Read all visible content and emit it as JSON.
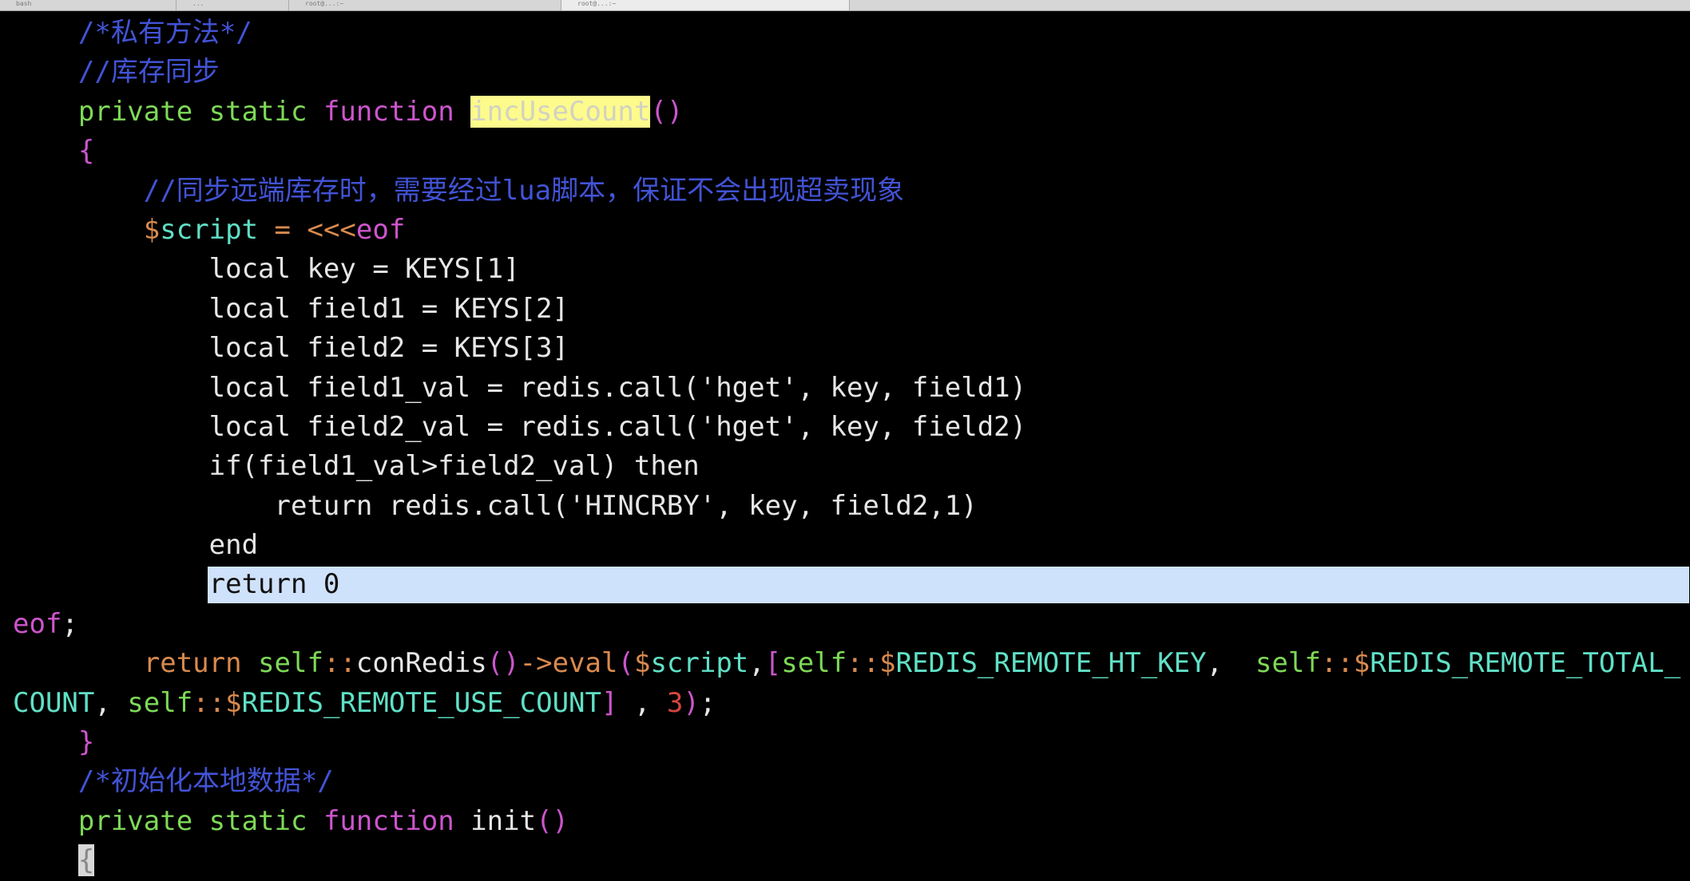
{
  "tabs": [
    {
      "label": "bash"
    },
    {
      "label": "..."
    },
    {
      "label": "root@...:~"
    },
    {
      "label": "root@...:~"
    }
  ],
  "colors": {
    "background": "#000000",
    "comment": "#4253d6",
    "keyword": "#7ed957",
    "function": "#cd55cd",
    "operator": "#d98a4e",
    "variable": "#60e0c6",
    "search_highlight": "#fdfb8c",
    "selection": "#cfe2fb"
  },
  "editor": {
    "selected_line_index": 14,
    "lines": [
      [
        {
          "t": "    "
        },
        {
          "t": "/*私有方法*/",
          "c": "comment"
        }
      ],
      [
        {
          "t": "    "
        },
        {
          "t": "//库存同步",
          "c": "comment"
        }
      ],
      [
        {
          "t": "    "
        },
        {
          "t": "private static ",
          "c": "kw"
        },
        {
          "t": "function ",
          "c": "fn"
        },
        {
          "t": "incUseCount",
          "c": "hl"
        },
        {
          "t": "()",
          "c": "punc"
        }
      ],
      [
        {
          "t": "    "
        },
        {
          "t": "{",
          "c": "punc"
        }
      ],
      [
        {
          "t": "        "
        },
        {
          "t": "//同步远端库存时，需要经过lua脚本，保证不会出现超卖现象",
          "c": "comment"
        }
      ],
      [
        {
          "t": "        "
        },
        {
          "t": "$",
          "c": "op"
        },
        {
          "t": "script",
          "c": "var"
        },
        {
          "t": " = <<<",
          "c": "op"
        },
        {
          "t": "eof",
          "c": "fn"
        }
      ],
      [
        {
          "t": "            local key = KEYS[1]"
        }
      ],
      [
        {
          "t": "            local field1 = KEYS[2]"
        }
      ],
      [
        {
          "t": "            local field2 = KEYS[3]"
        }
      ],
      [
        {
          "t": "            local field1_val = redis.call('hget', key, field1)"
        }
      ],
      [
        {
          "t": "            local field2_val = redis.call('hget', key, field2)"
        }
      ],
      [
        {
          "t": "            if(field1_val>field2_val) then"
        }
      ],
      [
        {
          "t": "                return redis.call('HINCRBY', key, field2,1)"
        }
      ],
      [
        {
          "t": "            end"
        }
      ],
      [
        {
          "t": "            "
        },
        {
          "t": "return 0",
          "c": "sel"
        }
      ],
      [
        {
          "t": "eof",
          "c": "fn"
        },
        {
          "t": ";"
        }
      ],
      [
        {
          "t": "        "
        },
        {
          "t": "return ",
          "c": "op"
        },
        {
          "t": "self",
          "c": "kw"
        },
        {
          "t": "::",
          "c": "op"
        },
        {
          "t": "conRedis"
        },
        {
          "t": "()",
          "c": "punc"
        },
        {
          "t": "->",
          "c": "op"
        },
        {
          "t": "eval",
          "c": "op"
        },
        {
          "t": "(",
          "c": "punc"
        },
        {
          "t": "$",
          "c": "op"
        },
        {
          "t": "script",
          "c": "var"
        },
        {
          "t": ","
        },
        {
          "t": "[",
          "c": "punc"
        },
        {
          "t": "self",
          "c": "kw"
        },
        {
          "t": "::",
          "c": "op"
        },
        {
          "t": "$",
          "c": "op"
        },
        {
          "t": "REDIS_REMOTE_HT_KEY",
          "c": "var"
        },
        {
          "t": ",  "
        },
        {
          "t": "self",
          "c": "kw"
        },
        {
          "t": "::",
          "c": "op"
        },
        {
          "t": "$",
          "c": "op"
        },
        {
          "t": "REDIS_REMOTE_TOTAL_",
          "c": "var"
        }
      ],
      [
        {
          "t": "COUNT",
          "c": "var"
        },
        {
          "t": ", "
        },
        {
          "t": "self",
          "c": "kw"
        },
        {
          "t": "::",
          "c": "op"
        },
        {
          "t": "$",
          "c": "op"
        },
        {
          "t": "REDIS_REMOTE_USE_COUNT",
          "c": "var"
        },
        {
          "t": "]",
          "c": "punc"
        },
        {
          "t": " , "
        },
        {
          "t": "3",
          "c": "num"
        },
        {
          "t": ")",
          "c": "punc"
        },
        {
          "t": ";"
        }
      ],
      [
        {
          "t": "    "
        },
        {
          "t": "}",
          "c": "punc"
        }
      ],
      [
        {
          "t": "    "
        },
        {
          "t": "/*初始化本地数据*/",
          "c": "comment"
        }
      ],
      [
        {
          "t": "    "
        },
        {
          "t": "private static ",
          "c": "kw"
        },
        {
          "t": "function ",
          "c": "fn"
        },
        {
          "t": "init"
        },
        {
          "t": "()",
          "c": "punc"
        }
      ],
      [
        {
          "t": "    "
        },
        {
          "t": "{",
          "c": "cursor"
        }
      ]
    ]
  }
}
